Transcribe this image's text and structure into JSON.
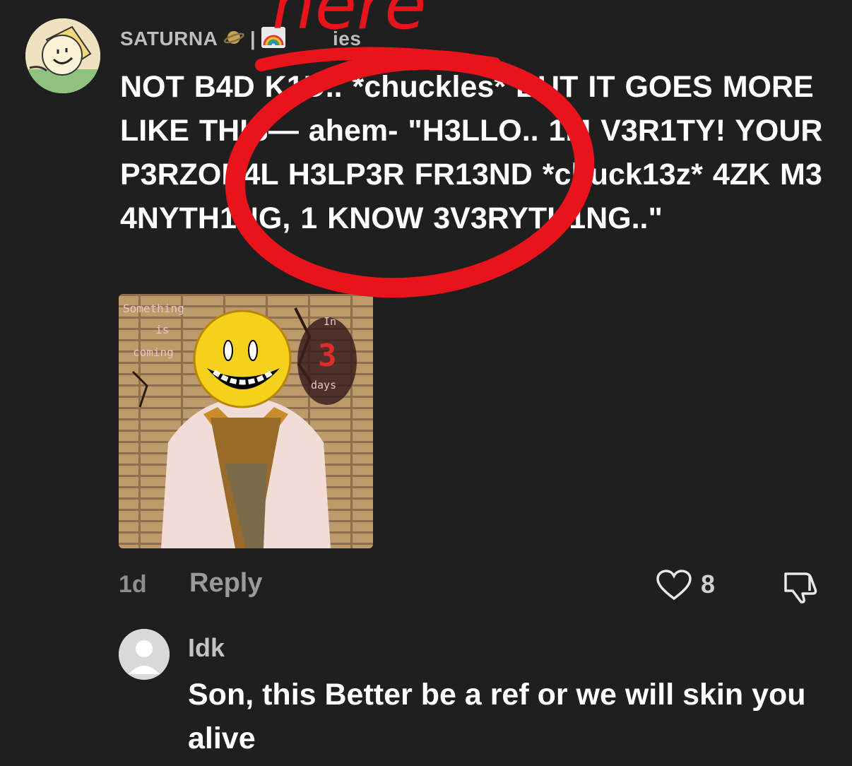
{
  "comment": {
    "username": "SATURNA",
    "username_suffix": "ies",
    "text": "NOT B4D K1D.. *chuckles* BUT IT GOES MORE LIKE THIS— ahem- \"H3LLO.. 1M V3R1TY! YOUR P3RZON4L H3LP3R FR13ND *chuck13z* 4ZK M3 4NYTH1NG, 1 KNOW 3V3RYTH1NG..\"",
    "timestamp": "1d",
    "reply_label": "Reply",
    "likes": "8",
    "image": {
      "caption_left_1": "Something",
      "caption_left_2": "is",
      "caption_left_3": "coming",
      "caption_right_1": "In",
      "caption_right_number": "3",
      "caption_right_3": "days"
    }
  },
  "reply": {
    "username": "Idk",
    "text": "Son, this Better be a ref or we will skin you alive"
  },
  "annotation": {
    "label": "here",
    "color": "#e8131b"
  },
  "icons": {
    "planet": "planet-emoji-icon",
    "rainbow": "rainbow-emoji-icon",
    "heart": "heart-icon",
    "dislike": "thumbs-down-icon"
  }
}
